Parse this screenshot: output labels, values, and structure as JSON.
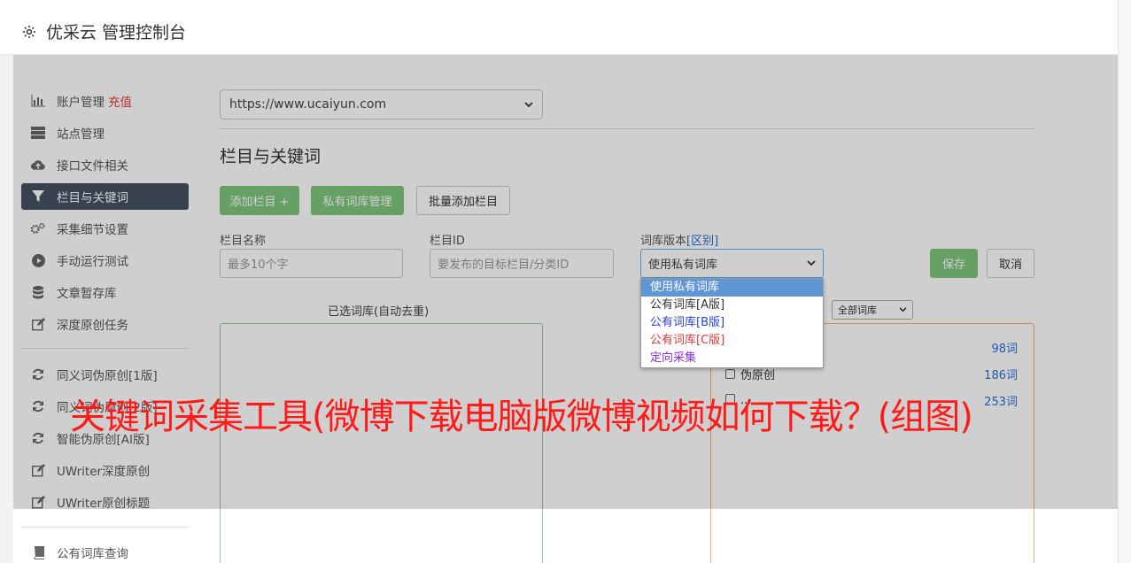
{
  "app": {
    "title": "优采云 管理控制台"
  },
  "sidebar": {
    "items": [
      {
        "label": "账户管理",
        "extra": "充值",
        "icon": "bar-chart-icon"
      },
      {
        "label": "站点管理",
        "icon": "server-icon"
      },
      {
        "label": "接口文件相关",
        "icon": "cloud-upload-icon"
      },
      {
        "label": "栏目与关键词",
        "icon": "filter-icon"
      },
      {
        "label": "采集细节设置",
        "icon": "gears-icon"
      },
      {
        "label": "手动运行测试",
        "icon": "play-circle-icon"
      },
      {
        "label": "文章暂存库",
        "icon": "database-icon"
      },
      {
        "label": "深度原创任务",
        "icon": "edit-icon"
      },
      {
        "label": "同义词伪原创[1版]",
        "icon": "refresh-icon"
      },
      {
        "label": "同义词伪原创[2版]",
        "icon": "refresh-icon"
      },
      {
        "label": "智能伪原创[AI版]",
        "icon": "refresh-icon"
      },
      {
        "label": "UWriter深度原创",
        "icon": "edit-icon"
      },
      {
        "label": "UWriter原创标题",
        "icon": "edit-icon"
      },
      {
        "label": "公有词库查询",
        "icon": "book-icon"
      }
    ],
    "active_index": 3
  },
  "main": {
    "site_select": "https://www.ucaiyun.com",
    "section_title": "栏目与关键词",
    "buttons": {
      "add_column": "添加栏目 +",
      "private_lib": "私有词库管理",
      "batch_add": "批量添加栏目",
      "save": "保存",
      "cancel": "取消"
    },
    "form": {
      "column_name_label": "栏目名称",
      "column_name_placeholder": "最多10个字",
      "column_id_label": "栏目ID",
      "column_id_placeholder": "要发布的目标栏目/分类ID",
      "lib_version_label": "词库版本",
      "lib_version_link": "[区别]",
      "lib_version_value": "使用私有词库"
    },
    "selected_list_title": "已选词库(自动去重)",
    "filter_select": "全部词库",
    "library_rows": [
      {
        "name": "",
        "count": "98词"
      },
      {
        "name": "伪原创",
        "count": "186词"
      },
      {
        "name": "...",
        "count": "253词"
      }
    ]
  },
  "dropdown": {
    "options": [
      {
        "label": "使用私有词库",
        "color": "#ffffff"
      },
      {
        "label": "公有词库[A版]",
        "color": "#333333"
      },
      {
        "label": "公有词库[B版]",
        "color": "#2a3fd6"
      },
      {
        "label": "公有词库[C版]",
        "color": "#d63a3a"
      },
      {
        "label": "定向采集",
        "color": "#8a2be2"
      }
    ]
  },
  "overlay_caption": "关键词采集工具(微博下载电脑版微博视频如何下载？(组图)"
}
